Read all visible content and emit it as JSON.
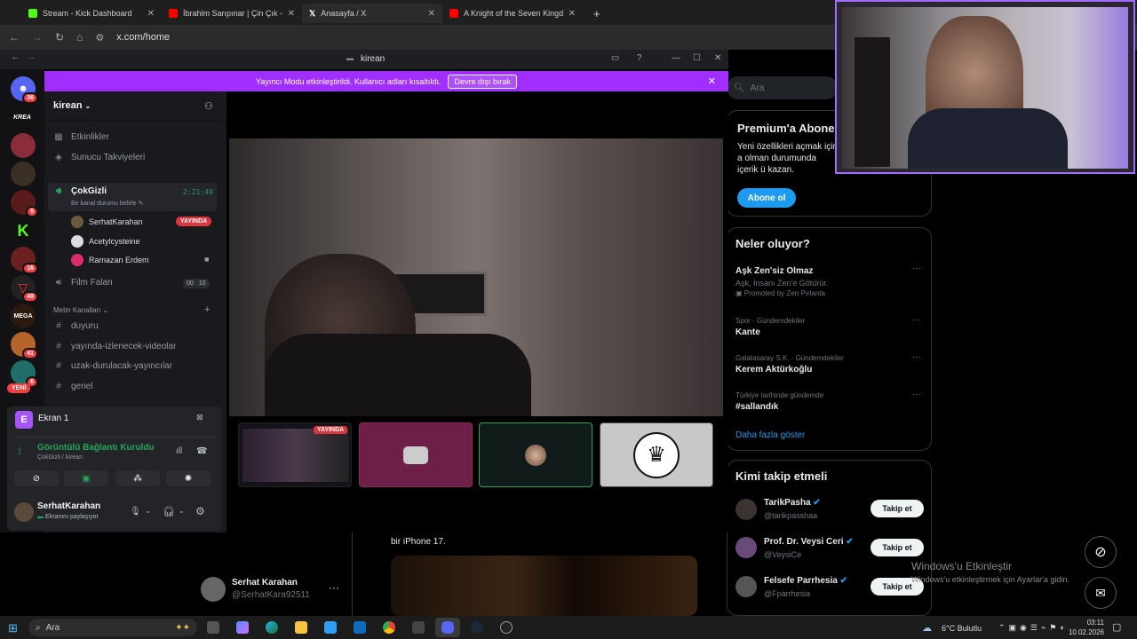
{
  "browser": {
    "tabs": [
      {
        "label": "Stream - Kick Dashboard",
        "color": "#53fc18"
      },
      {
        "label": "İbrahim Sarıpınar | Çin Çık - You",
        "color": "#ff0000"
      },
      {
        "label": "Anasayfa / X",
        "color": "#ffffff"
      },
      {
        "label": "A Knight of the Seven Kingdom",
        "color": "#ff0000"
      }
    ],
    "new_tab": "+",
    "url": "x.com/home"
  },
  "discord": {
    "window_title": "kirean",
    "banner_text": "Yayıncı Modu etkinleştirildi. Kullanıcı adları kısaltıldı.",
    "banner_button": "Devre dışı bırak",
    "server_name": "kirean",
    "guild_badges": [
      "36",
      "5",
      "16",
      "49",
      "41",
      "6"
    ],
    "guild_new": "YENİ",
    "menu": {
      "events": "Etkinlikler",
      "boosts": "Sunucu Takviyeleri"
    },
    "voice_channel": {
      "name": "ÇokGizli",
      "timer": "2:21:49",
      "status": "Bir kanal durumu belirle"
    },
    "voice_users": [
      {
        "name": "SerhatKarahan",
        "badge": "YAYINDA"
      },
      {
        "name": "Acetylcysteine"
      },
      {
        "name": "Ramazan Erdem"
      }
    ],
    "voice_channel2": {
      "name": "Film Falan",
      "count1": "00",
      "count2": "10"
    },
    "text_category": "Metin Kanalları",
    "text_channels": [
      "duyuru",
      "yayında-izlenecek-videolar",
      "uzak-durulacak-yayıncılar",
      "genel"
    ],
    "screen_panel": {
      "letter": "E",
      "title": "Ekran 1"
    },
    "connection": {
      "status": "Görüntülü Bağlantı Kuruldu",
      "sub": "ÇokGizli / kirean"
    },
    "user": {
      "name": "SerhatKarahan",
      "status": "Ekranını paylaşıyor"
    },
    "stream_tile_badge": "YAYINDA"
  },
  "x": {
    "search_placeholder": "Ara",
    "premium": {
      "title": "Premium'a Abone",
      "text": "Yeni özellikleri açmak için a olman durumunda içerik ü kazan.",
      "button": "Abone ol"
    },
    "trends_title": "Neler oluyor?",
    "trends": [
      {
        "meta": "",
        "name": "Aşk Zen'siz Olmaz",
        "sub": "Aşk, İnsanı Zen'e Götürür.",
        "promo": "Promoted by Zen Pırlanta"
      },
      {
        "meta": "Spor · Gündemdekiler",
        "name": "Kante"
      },
      {
        "meta": "Galatasaray S.K. · Gündemdekiler",
        "name": "Kerem Aktürkoğlu"
      },
      {
        "meta": "Türkiye tarihinde gündemde",
        "name": "#sallandık"
      }
    ],
    "show_more": "Daha fazla göster",
    "who_to_follow_title": "Kimi takip etmeli",
    "who_to_follow": [
      {
        "name": "TarikPasha",
        "handle": "@tarikpasshaa",
        "button": "Takip et"
      },
      {
        "name": "Prof. Dr. Veysi Ceri",
        "handle": "@VeysiCe",
        "button": "Takip et"
      },
      {
        "name": "Felsefe Parrhesia",
        "handle": "@Fparrhesia",
        "button": "Takip et"
      }
    ],
    "post_text": "bir iPhone 17.",
    "account": {
      "name": "Serhat Karahan",
      "handle": "@SerhatKara92511"
    }
  },
  "windows": {
    "activate_title": "Windows'u Etkinleştir",
    "activate_sub": "Windows'u etkinleştirmek için Ayarlar'a gidin.",
    "search": "Ara",
    "weather": "6°C  Bulutlu",
    "time": "03:11",
    "date": "10.02.2026"
  },
  "colors": {
    "discord_accent": "#a02fff",
    "x_blue": "#1d9bf0",
    "live_red": "#da373c",
    "green": "#23a55a"
  }
}
